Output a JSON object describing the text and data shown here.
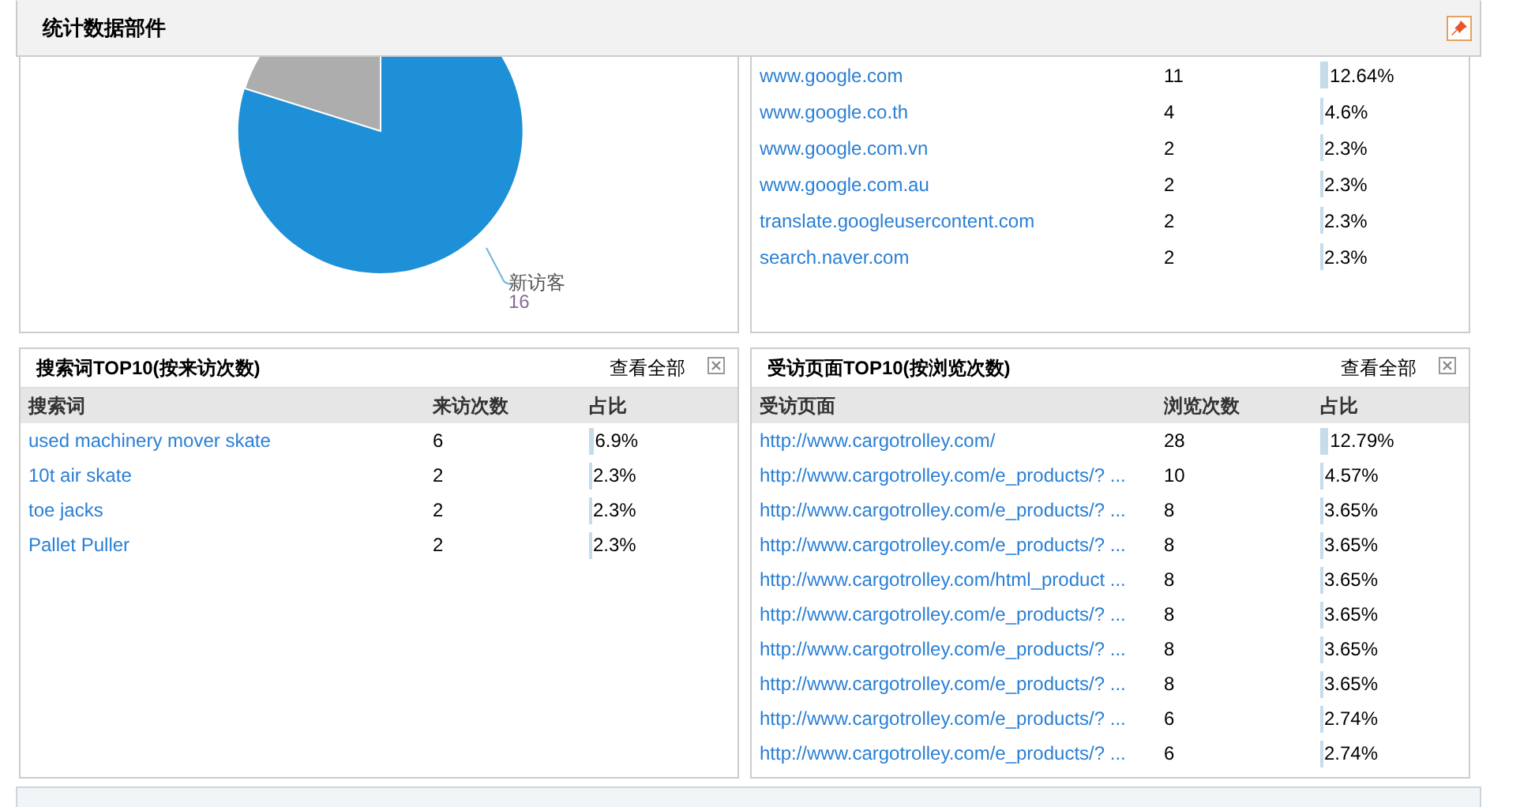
{
  "header": {
    "title": "统计数据部件"
  },
  "visitor_pie": {
    "label": "新访客",
    "value": "16"
  },
  "referrer_table": {
    "rows": [
      {
        "site": "www.google.com",
        "count": "11",
        "share": "12.64%"
      },
      {
        "site": "www.google.co.th",
        "count": "4",
        "share": "4.6%"
      },
      {
        "site": "www.google.com.vn",
        "count": "2",
        "share": "2.3%"
      },
      {
        "site": "www.google.com.au",
        "count": "2",
        "share": "2.3%"
      },
      {
        "site": "translate.googleusercontent.com",
        "count": "2",
        "share": "2.3%"
      },
      {
        "site": "search.naver.com",
        "count": "2",
        "share": "2.3%"
      }
    ]
  },
  "panels": [
    {
      "title": "搜索词TOP10(按来访次数)",
      "view_all": "查看全部",
      "columns": [
        "搜索词",
        "来访次数",
        "占比"
      ],
      "rows": [
        {
          "name": "used machinery mover skate",
          "count": "6",
          "share": "6.9%"
        },
        {
          "name": "10t air skate",
          "count": "2",
          "share": "2.3%"
        },
        {
          "name": "toe jacks",
          "count": "2",
          "share": "2.3%"
        },
        {
          "name": "Pallet Puller",
          "count": "2",
          "share": "2.3%"
        }
      ]
    },
    {
      "title": "受访页面TOP10(按浏览次数)",
      "view_all": "查看全部",
      "columns": [
        "受访页面",
        "浏览次数",
        "占比"
      ],
      "rows": [
        {
          "name": "http://www.cargotrolley.com/",
          "count": "28",
          "share": "12.79%"
        },
        {
          "name": "http://www.cargotrolley.com/e_products/? ...",
          "count": "10",
          "share": "4.57%"
        },
        {
          "name": "http://www.cargotrolley.com/e_products/? ...",
          "count": "8",
          "share": "3.65%"
        },
        {
          "name": "http://www.cargotrolley.com/e_products/? ...",
          "count": "8",
          "share": "3.65%"
        },
        {
          "name": "http://www.cargotrolley.com/html_product ...",
          "count": "8",
          "share": "3.65%"
        },
        {
          "name": "http://www.cargotrolley.com/e_products/? ...",
          "count": "8",
          "share": "3.65%"
        },
        {
          "name": "http://www.cargotrolley.com/e_products/? ...",
          "count": "8",
          "share": "3.65%"
        },
        {
          "name": "http://www.cargotrolley.com/e_products/? ...",
          "count": "8",
          "share": "3.65%"
        },
        {
          "name": "http://www.cargotrolley.com/e_products/? ...",
          "count": "6",
          "share": "2.74%"
        },
        {
          "name": "http://www.cargotrolley.com/e_products/? ...",
          "count": "6",
          "share": "2.74%"
        }
      ]
    }
  ]
}
